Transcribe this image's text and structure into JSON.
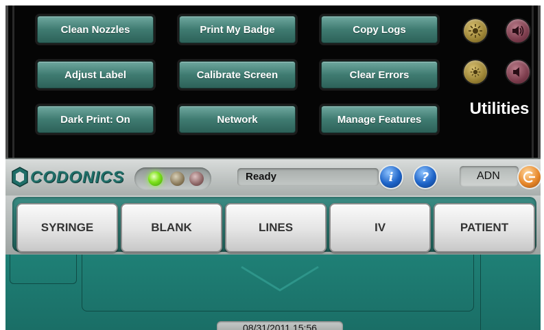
{
  "utilities": {
    "title": "Utilities",
    "buttons": [
      [
        "Clean Nozzles",
        "Print My Badge",
        "Copy Logs"
      ],
      [
        "Adjust Label",
        "Calibrate Screen",
        "Clear Errors"
      ],
      [
        "Dark Print: On",
        "Network",
        "Manage Features"
      ]
    ],
    "icons": [
      "brightness-up-icon",
      "volume-up-icon",
      "brightness-down-icon",
      "volume-down-icon"
    ]
  },
  "header": {
    "brand": "CODONICS",
    "status": "Ready",
    "user": "ADN",
    "indicators": [
      "green",
      "amber",
      "red"
    ]
  },
  "categories": [
    "SYRINGE",
    "BLANK",
    "LINES",
    "IV",
    "PATIENT"
  ],
  "footer": {
    "datetime": "08/31/2011 15:56"
  },
  "colors": {
    "accent": "#2e7a70",
    "panel": "#050505",
    "category_bg": "#1f5f58"
  }
}
